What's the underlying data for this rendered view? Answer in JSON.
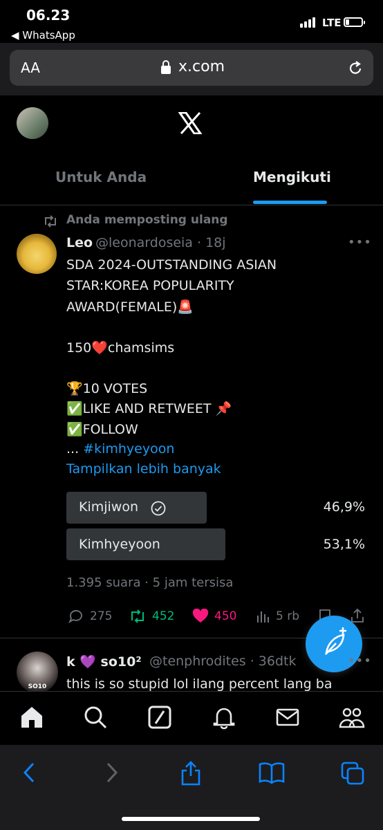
{
  "status": {
    "time": "06.23",
    "back_app": "◀ WhatsApp",
    "network": "LTE"
  },
  "browser": {
    "text_size": "AA",
    "url": "x.com"
  },
  "tabs": [
    {
      "label": "Untuk Anda"
    },
    {
      "label": "Mengikuti"
    }
  ],
  "tweet": {
    "repost_label": "Anda memposting ulang",
    "name": "Leo",
    "handle_time": "@leonardoseia · 18j",
    "lines": [
      "SDA 2024-OUTSTANDING ASIAN",
      "STAR:KOREA POPULARITY",
      "AWARD(FEMALE)🚨",
      "150❤️chamsims",
      "🏆10 VOTES",
      "✅LIKE AND RETWEET 📌",
      "✅FOLLOW"
    ],
    "truncated_prefix": "... ",
    "hashtag": "#kimhyeyoon",
    "show_more": "Tampilkan lebih banyak",
    "poll": {
      "options": [
        {
          "label": "Kimjiwon",
          "percent": "46,9%",
          "share": 0.469,
          "selected": true
        },
        {
          "label": "Kimhyeyoon",
          "percent": "53,1%",
          "share": 0.531,
          "selected": false
        }
      ],
      "meta": "1.395 suara · 5 jam tersisa"
    },
    "actions": {
      "replies": "275",
      "reposts": "452",
      "likes": "450",
      "views": "5 rb"
    }
  },
  "tweet2": {
    "name": "k 💜 so10²",
    "handle_time": "@tenphrodites · 36dtk",
    "text": "this is so stupid lol ilang percent lang ba",
    "avatar_text": "SO10"
  },
  "colors": {
    "accent": "#1d9bf0",
    "repost": "#00ba7c",
    "like": "#f91880",
    "muted": "#71767b"
  },
  "icons": {
    "nav": [
      "home-icon",
      "search-icon",
      "grok-icon",
      "notifications-icon",
      "messages-icon",
      "communities-icon"
    ],
    "safari": [
      "back-icon",
      "forward-icon",
      "share-icon",
      "bookmarks-icon",
      "tabs-icon"
    ]
  }
}
